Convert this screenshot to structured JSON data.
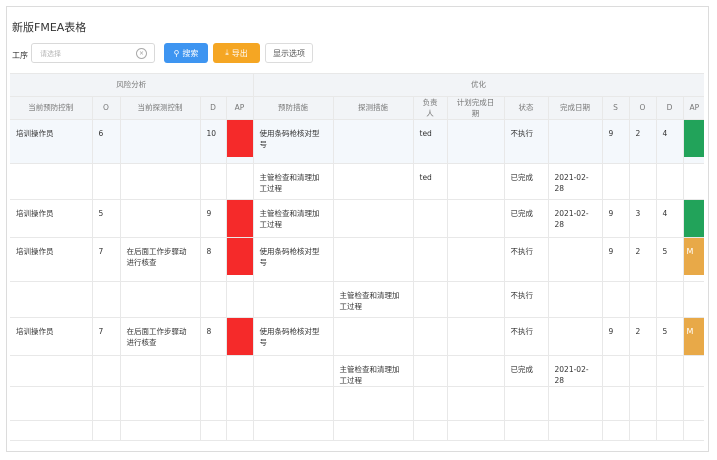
{
  "page": {
    "title": "新版FMEA表格"
  },
  "filter": {
    "label": "工序",
    "placeholder": "请选择",
    "search_label": "搜索",
    "export_label": "导出",
    "options_label": "显示选项"
  },
  "table": {
    "groups": {
      "risk": "风险分析",
      "opt": "优化"
    },
    "columns": {
      "prevent_ctrl": "当前预防控制",
      "o": "O",
      "detect_ctrl": "当前探测控制",
      "d": "D",
      "ap": "AP",
      "prevent_act": "预防措施",
      "detect_act": "探测措施",
      "owner": "负责人",
      "plan_date": "计划完成日期",
      "status": "状态",
      "done_date": "完成日期",
      "s2": "S",
      "o2": "O",
      "d2": "D",
      "ap2": "AP"
    },
    "rows": [
      {
        "pc": "培训操作员",
        "o": "6",
        "dc": "",
        "d": "10",
        "ap": "red",
        "pa": "使用条码枪核对型号",
        "da": "",
        "owner": "ted",
        "plan": "",
        "status": "不执行",
        "done": "",
        "s2": "9",
        "o2": "2",
        "d2": "4",
        "ap2": "green",
        "ap2t": ""
      },
      {
        "pc": "",
        "o": "",
        "dc": "",
        "d": "",
        "ap": "",
        "pa": "主管检查和清理加工过程",
        "da": "",
        "owner": "ted",
        "plan": "",
        "status": "已完成",
        "done": "2021-02-28",
        "s2": "",
        "o2": "",
        "d2": "",
        "ap2": "",
        "ap2t": ""
      },
      {
        "pc": "培训操作员",
        "o": "5",
        "dc": "",
        "d": "9",
        "ap": "red",
        "pa": "主管检查和清理加工过程",
        "da": "",
        "owner": "",
        "plan": "",
        "status": "已完成",
        "done": "2021-02-28",
        "s2": "9",
        "o2": "3",
        "d2": "4",
        "ap2": "green",
        "ap2t": ""
      },
      {
        "pc": "培训操作员",
        "o": "7",
        "dc": "在后面工作步骤动进行核查",
        "d": "8",
        "ap": "red",
        "pa": "使用条码枪核对型号",
        "da": "",
        "owner": "",
        "plan": "",
        "status": "不执行",
        "done": "",
        "s2": "9",
        "o2": "2",
        "d2": "5",
        "ap2": "orange",
        "ap2t": "M"
      },
      {
        "pc": "",
        "o": "",
        "dc": "",
        "d": "",
        "ap": "",
        "pa": "",
        "da": "主管检查和清理加工过程",
        "owner": "",
        "plan": "",
        "status": "不执行",
        "done": "",
        "s2": "",
        "o2": "",
        "d2": "",
        "ap2": "",
        "ap2t": ""
      },
      {
        "pc": "培训操作员",
        "o": "7",
        "dc": "在后面工作步骤动进行核查",
        "d": "8",
        "ap": "red",
        "pa": "使用条码枪核对型号",
        "da": "",
        "owner": "",
        "plan": "",
        "status": "不执行",
        "done": "",
        "s2": "9",
        "o2": "2",
        "d2": "5",
        "ap2": "orange",
        "ap2t": "M"
      },
      {
        "pc": "",
        "o": "",
        "dc": "",
        "d": "",
        "ap": "",
        "pa": "",
        "da": "主管检查和清理加工过程",
        "owner": "",
        "plan": "",
        "status": "已完成",
        "done": "2021-02-28",
        "s2": "",
        "o2": "",
        "d2": "",
        "ap2": "",
        "ap2t": ""
      }
    ]
  }
}
